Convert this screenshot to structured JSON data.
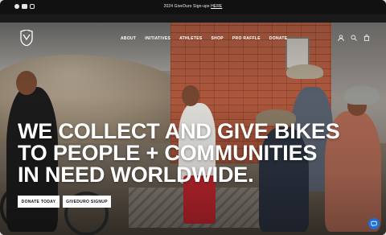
{
  "announcement": {
    "text": "2024 GiveDuro Sign-ups ",
    "link": "HERE"
  },
  "socials": [
    "facebook-icon",
    "youtube-icon",
    "instagram-icon"
  ],
  "nav": {
    "items": [
      "ABOUT",
      "INITIATIVES",
      "ATHLETES",
      "SHOP",
      "PRO RAFFLE",
      "DONATE"
    ],
    "icons": [
      "account-icon",
      "search-icon",
      "cart-icon"
    ]
  },
  "hero": {
    "headline_lines": [
      "WE COLLECT AND GIVE BIKES",
      "TO PEOPLE + COMMUNITIES",
      "IN NEED WORLDWIDE."
    ],
    "buttons": {
      "donate": "DONATE TODAY",
      "signup": "GIVEDURO SIGNUP"
    }
  },
  "colors": {
    "accent": "#1e6fd9",
    "topbar": "#111111",
    "text": "#ffffff"
  }
}
